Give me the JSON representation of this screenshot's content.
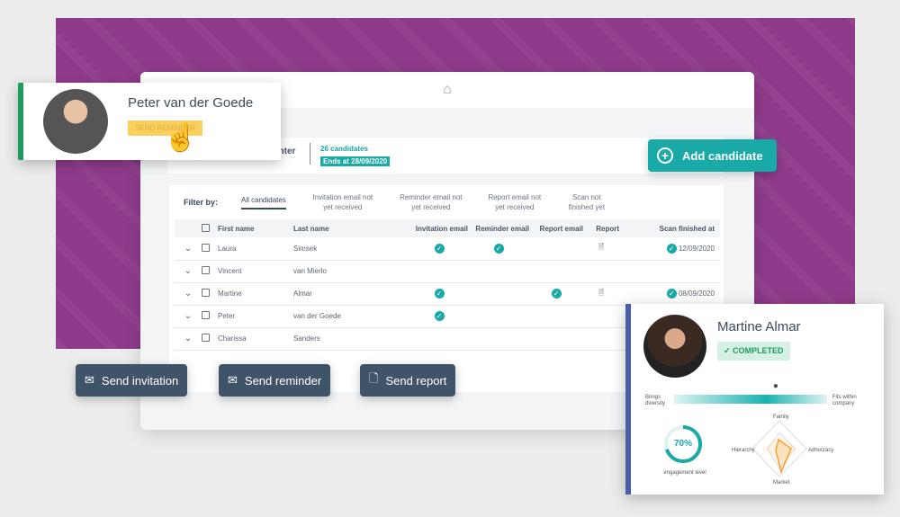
{
  "app": {
    "home_icon": "home-icon",
    "header_title": "enter",
    "candidates": "26 candidates",
    "ends": "Ends at 28/09/2020"
  },
  "filter": {
    "label": "Filter by:",
    "tabs": [
      "All candidates",
      "Invitation email not yet received",
      "Reminder email not yet received",
      "Report email not yet received",
      "Scan not finished yet"
    ]
  },
  "table": {
    "columns": [
      "First name",
      "Last name",
      "Invitation email",
      "Reminder email",
      "Report email",
      "Report",
      "Scan finished at"
    ],
    "rows": [
      {
        "first": "Laura",
        "last": "Simsek",
        "inv": true,
        "rem": true,
        "rep": false,
        "report": true,
        "scan": "12/09/2020"
      },
      {
        "first": "Vincent",
        "last": "van Mierlo",
        "inv": false,
        "rem": false,
        "rep": false,
        "report": false,
        "scan": ""
      },
      {
        "first": "Martine",
        "last": "Almar",
        "inv": true,
        "rem": false,
        "rep": true,
        "report": true,
        "scan": "08/09/2020"
      },
      {
        "first": "Peter",
        "last": "van der Goede",
        "inv": true,
        "rem": false,
        "rep": false,
        "report": false,
        "scan": ""
      },
      {
        "first": "Charissa",
        "last": "Sanders",
        "inv": false,
        "rem": false,
        "rep": false,
        "report": false,
        "scan": ""
      }
    ]
  },
  "reminder_card": {
    "name": "Peter van der Goede",
    "button": "SEND REMINDER"
  },
  "add_candidate": "Add candidate",
  "actions": {
    "invitation": "Send invitation",
    "reminder": "Send reminder",
    "report": "Send report"
  },
  "result_card": {
    "name": "Martine Almar",
    "status": "COMPLETED",
    "left": "Brings diversity",
    "right": "Fits within company",
    "fit_fraction": 0.67,
    "engagement": "70%",
    "engagement_value": 70,
    "engagement_label": "engagement level",
    "radar": [
      "Family",
      "Adhocracy",
      "Market",
      "Hierarchy"
    ]
  },
  "colors": {
    "accent": "#19a9a6",
    "purple": "#8e3a8a",
    "button": "#3f5469",
    "green": "#1f9d60"
  }
}
